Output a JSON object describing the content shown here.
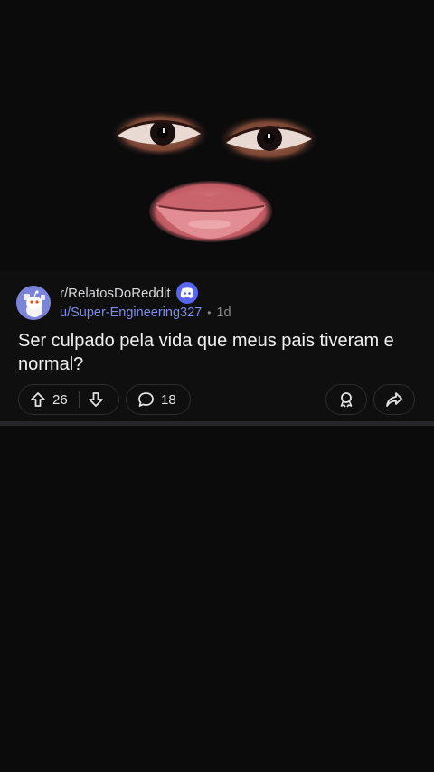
{
  "post": {
    "subreddit": "r/RelatosDoReddit",
    "author": "u/Super-Engineering327",
    "separator": "•",
    "age": "1d",
    "title": "Ser culpado pela vida que meus pais tiveram e normal?",
    "upvotes": "26",
    "comments": "18"
  },
  "icons": {
    "avatar": "reddit-snoo-avatar",
    "badge": "discord-icon",
    "upvote": "arrow-up-icon",
    "downvote": "arrow-down-icon",
    "comment": "comment-bubble-icon",
    "award": "award-icon",
    "share": "share-icon"
  },
  "colors": {
    "background": "#0b0b0c",
    "username": "#7c8ce8",
    "discord": "#5865f2",
    "avatar": "#7b84d9"
  }
}
